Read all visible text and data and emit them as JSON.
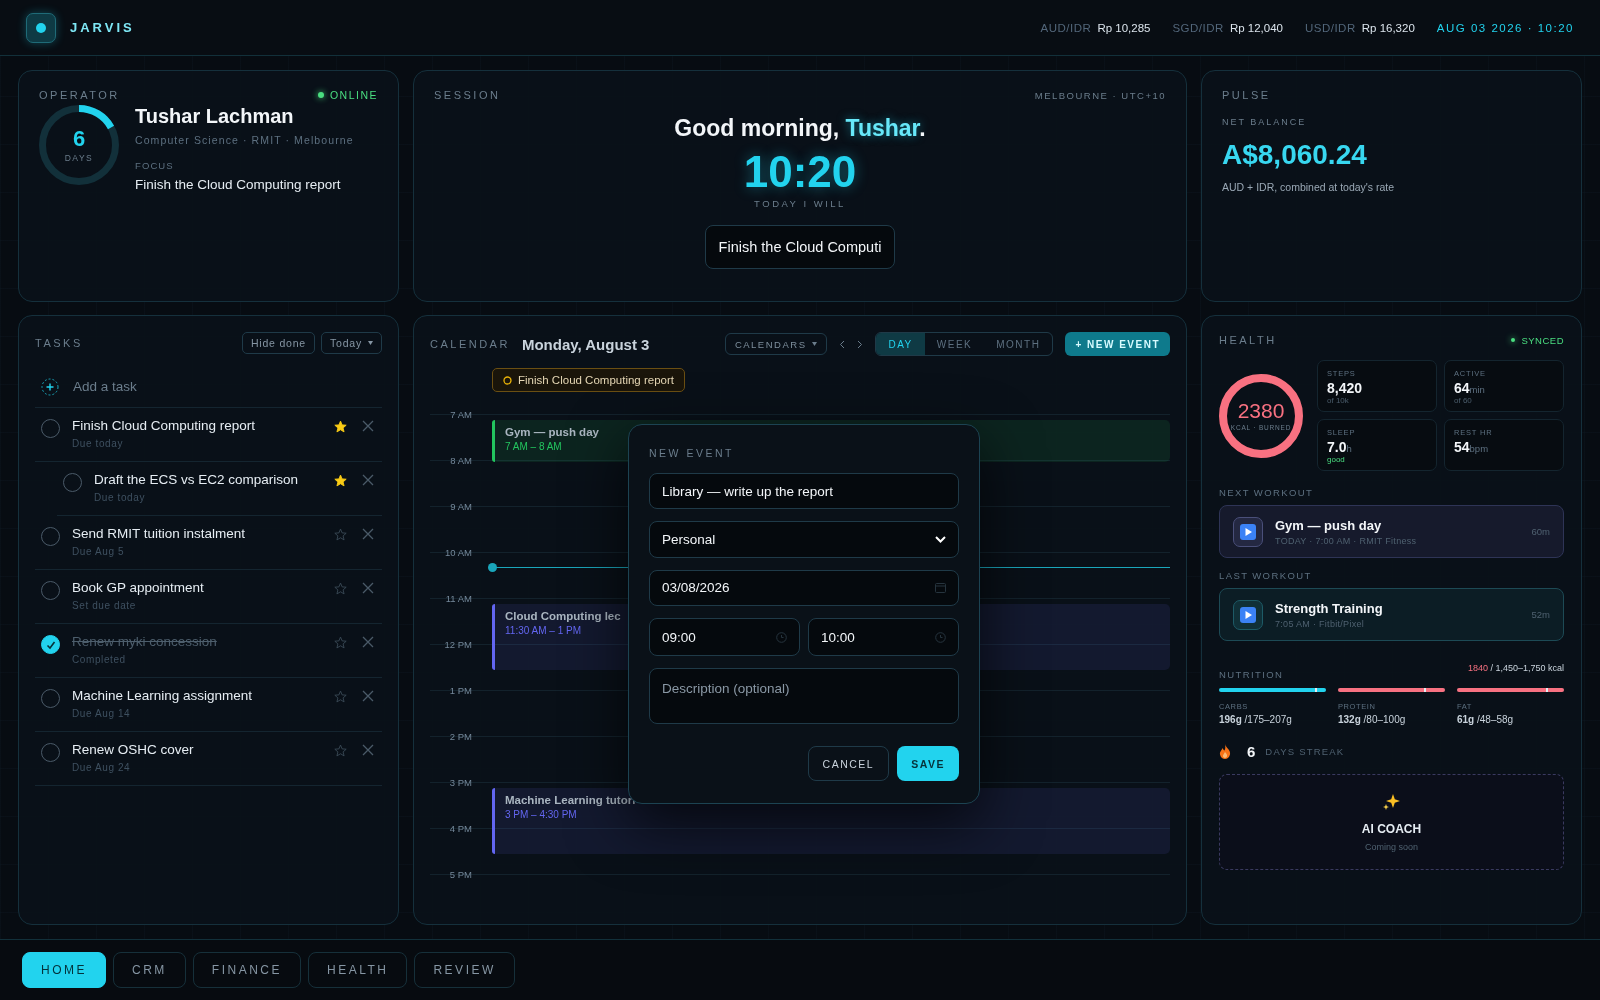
{
  "header": {
    "logo": "JARVIS",
    "rates": [
      {
        "pair": "AUD/IDR",
        "value": "Rp 10,285"
      },
      {
        "pair": "SGD/IDR",
        "value": "Rp 12,040"
      },
      {
        "pair": "USD/IDR",
        "value": "Rp 16,320"
      }
    ],
    "datetime": "AUG 03 2026 · 10:20"
  },
  "operator": {
    "title": "OPERATOR",
    "status": "ONLINE",
    "online": true,
    "streak": {
      "value": "6",
      "unit": "DAYS",
      "level": 0.17
    },
    "name": "Tushar Lachman",
    "subtitle": "Computer Science · RMIT · Melbourne",
    "focus_label": "FOCUS",
    "focus": "Finish the Cloud Computing report"
  },
  "session": {
    "title": "SESSION",
    "location": "MELBOURNE · UTC+10",
    "greeting": "Good morning, ",
    "greeting_name": "Tushar",
    "greeting_end": ".",
    "time": "10:20",
    "caption": "TODAY I WILL",
    "intention": "Finish the Cloud Computi"
  },
  "pulse": {
    "title": "PULSE",
    "balance_label": "NET BALANCE",
    "balance": "A$8,060.24",
    "note": "AUD + IDR, combined at today's rate"
  },
  "tasks": {
    "title": "TASKS",
    "filters": [
      "Hide done",
      "Today"
    ],
    "add_placeholder": "Add a task",
    "items": [
      {
        "title": "Finish Cloud Computing report",
        "due": "Due today",
        "done": false,
        "starred": true,
        "children": [
          {
            "title": "Draft the ECS vs EC2 comparison",
            "due": "Due today",
            "done": false,
            "starred": true
          }
        ]
      },
      {
        "title": "Send RMIT tuition instalment",
        "due": "Due Aug 5",
        "done": false,
        "starred": false
      },
      {
        "title": "Book GP appointment",
        "due": "Set due date",
        "done": false,
        "starred": false
      },
      {
        "title": "Renew myki concession",
        "due": "Completed",
        "done": true,
        "starred": false
      },
      {
        "title": "Machine Learning assignment",
        "due": "Due Aug 14",
        "done": false,
        "starred": false
      },
      {
        "title": "Renew OSHC cover",
        "due": "Due Aug 24",
        "done": false,
        "starred": false
      }
    ]
  },
  "calendar": {
    "title": "CALENDAR",
    "date": "Monday, August 3",
    "calendars_button": "CALENDARS",
    "views": [
      {
        "label": "DAY",
        "selected": true
      },
      {
        "label": "WEEK",
        "selected": false
      },
      {
        "label": "MONTH",
        "selected": false
      }
    ],
    "new_event": "+ NEW EVENT",
    "all_day": [
      {
        "title": "Finish Cloud Computing report"
      }
    ],
    "hours": [
      "7 AM",
      "8 AM",
      "9 AM",
      "10 AM",
      "11 AM",
      "12 PM",
      "1 PM",
      "2 PM",
      "3 PM",
      "4 PM",
      "5 PM"
    ],
    "events": [
      {
        "title": "Gym — push day",
        "time": "7 AM – 8 AM",
        "color": "#22c55e"
      },
      {
        "title": "Cloud Computing lec",
        "time": "11:30 AM – 1 PM",
        "color": "#6366f1"
      },
      {
        "title": "Machine Learning tutori",
        "time": "3 PM – 4:30 PM",
        "color": "#6366f1"
      }
    ]
  },
  "new_event_dialog": {
    "title": "NEW EVENT",
    "event_title": "Library — write up the report",
    "calendar": "Personal",
    "date": "03/08/2026",
    "start": "09:00",
    "end": "10:00",
    "description_placeholder": "Description (optional)",
    "cancel": "CANCEL",
    "save": "SAVE"
  },
  "health": {
    "title": "HEALTH",
    "status": "SYNCED",
    "calories": {
      "value": "2380",
      "label": "KCAL · BURNED",
      "level": 1
    },
    "stats": [
      {
        "label": "STEPS",
        "value": "8,420",
        "sub": "of 10k",
        "kind": "target"
      },
      {
        "label": "ACTIVE",
        "value": "64",
        "unit": "min",
        "sub": "of 60",
        "kind": "target"
      },
      {
        "label": "SLEEP",
        "value": "7.0",
        "unit": "h",
        "sub": "good",
        "kind": "rating"
      },
      {
        "label": "REST HR",
        "value": "54",
        "unit": "bpm"
      }
    ],
    "next_workout_label": "NEXT WORKOUT",
    "next_workout": {
      "title": "Gym — push day",
      "meta": "TODAY · 7:00 AM · RMIT Fitness",
      "duration": "60m"
    },
    "last_workout_label": "LAST WORKOUT",
    "last_workout": {
      "title": "Strength Training",
      "meta": "7:05 AM · Fitbit/Pixel",
      "duration": "52m"
    },
    "nutrition": {
      "title": "NUTRITION",
      "total": "1840",
      "target": " / 1,450–1,750 kcal",
      "macros": [
        {
          "label": "CARBS",
          "value": "196g",
          "range": " /175–207g",
          "level": 1,
          "color": "#22d3ee"
        },
        {
          "label": "PROTEIN",
          "value": "132g",
          "range": " /80–100g",
          "level": 1,
          "color": "#f87181"
        },
        {
          "label": "FAT",
          "value": "61g",
          "range": " /48–58g",
          "level": 1,
          "color": "#f87181"
        }
      ]
    },
    "streak": {
      "value": "6",
      "label": "DAYS STREAK"
    },
    "coach": {
      "title": "AI COACH",
      "subtitle": "Coming soon"
    }
  },
  "nav": [
    {
      "label": "HOME",
      "selected": true
    },
    {
      "label": "CRM",
      "selected": false
    },
    {
      "label": "FINANCE",
      "selected": false
    },
    {
      "label": "HEALTH",
      "selected": false
    },
    {
      "label": "REVIEW",
      "selected": false
    }
  ]
}
